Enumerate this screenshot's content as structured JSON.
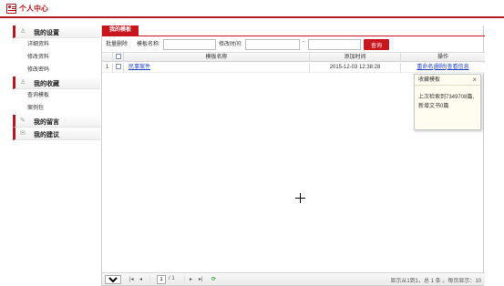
{
  "header": {
    "title": "个人中心"
  },
  "sidebar": {
    "groups": [
      {
        "label": "我的设置",
        "icon": "user-icon",
        "items": [
          "详细资料",
          "修改资料",
          "修改密码"
        ]
      },
      {
        "label": "我的收藏",
        "icon": "user-icon",
        "items": [
          "查询模板",
          "案例包"
        ]
      },
      {
        "label": "我的留言",
        "icon": "pencil-icon",
        "items": []
      },
      {
        "label": "我的建议",
        "icon": "mail-icon",
        "items": []
      }
    ]
  },
  "main": {
    "tab": "我的模板",
    "toolbar": {
      "batch_delete": "批量删除",
      "template_name_label": "模板名称:",
      "modified_time_label": "修改时间:",
      "range_separator": "-",
      "query_button": "查询"
    },
    "table": {
      "columns": [
        "模板名称",
        "添加时间",
        "操作"
      ],
      "rows": [
        {
          "index": "1",
          "name": "民事案件",
          "added": "2015-12-03 12:38:28",
          "actions": [
            "重命名",
            "删除",
            "查看信息"
          ]
        }
      ]
    },
    "popup": {
      "title": "收藏模板",
      "line1": "上次检索到7349708篇,",
      "line2": "新增文书0篇"
    },
    "pager": {
      "page_size": "10",
      "current_page": "1",
      "total_pages": "/ 1",
      "summary": "显示从1到1，总 1 条 。每页显示：10"
    }
  }
}
